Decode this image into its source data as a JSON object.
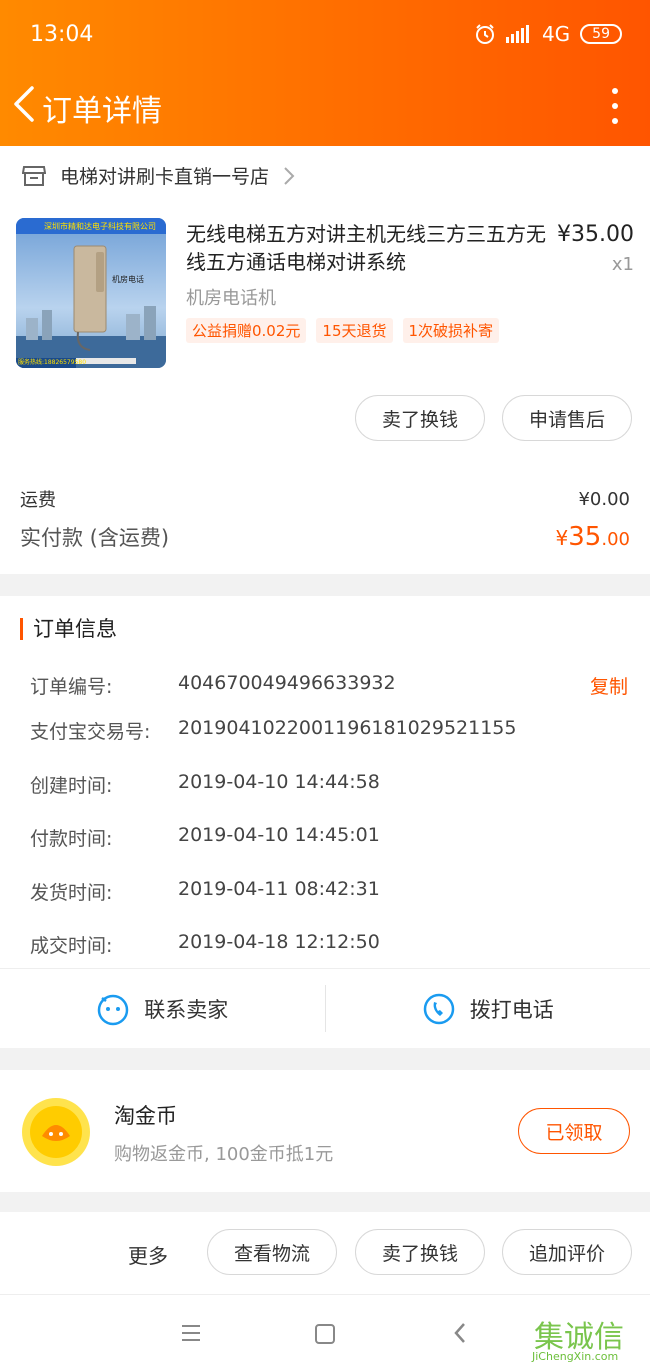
{
  "status_bar": {
    "time": "13:04",
    "network": "4G",
    "battery": "59"
  },
  "nav": {
    "title": "订单详情"
  },
  "store": {
    "name": "电梯对讲刷卡直销一号店"
  },
  "product": {
    "title": "无线电梯五方对讲主机无线三方三五方无线五方通话电梯对讲系统",
    "price": "¥35.00",
    "quantity": "x1",
    "spec": "机房电话机",
    "tags": [
      "公益捐赠0.02元",
      "15天退货",
      "1次破损补寄"
    ],
    "image_banner": "深圳市精和达电子科技有限公司",
    "image_label": "机房电话",
    "image_hotline": "服务热线:18826579580"
  },
  "actions_top": {
    "sell": "卖了换钱",
    "after_sale": "申请售后"
  },
  "fees": {
    "shipping_label": "运费",
    "shipping_value": "¥0.00",
    "total_label": "实付款 (含运费)",
    "total_currency": "¥",
    "total_int": "35",
    "total_dec": ".00"
  },
  "order_info": {
    "title": "订单信息",
    "copy_label": "复制",
    "rows": [
      {
        "label": "订单编号:",
        "value": "404670049496633932"
      },
      {
        "label": "支付宝交易号:",
        "value": "2019041022001196181029521155"
      },
      {
        "label": "创建时间:",
        "value": "2019-04-10 14:44:58"
      },
      {
        "label": "付款时间:",
        "value": "2019-04-10 14:45:01"
      },
      {
        "label": "发货时间:",
        "value": "2019-04-11 08:42:31"
      },
      {
        "label": "成交时间:",
        "value": "2019-04-18 12:12:50"
      }
    ]
  },
  "contact": {
    "seller": "联系卖家",
    "call": "拨打电话"
  },
  "coins": {
    "title": "淘金币",
    "subtitle": "购物返金币, 100金币抵1元",
    "button": "已领取"
  },
  "bottom": {
    "more": "更多",
    "logistics": "查看物流",
    "sell": "卖了换钱",
    "review": "追加评价"
  },
  "watermark": {
    "brand": "集诚信",
    "site": "JiChengXin.com"
  },
  "colors": {
    "accent": "#ff5500",
    "header_start": "#ff8a00",
    "header_end": "#ff5500",
    "link_blue": "#1a9bf0"
  }
}
